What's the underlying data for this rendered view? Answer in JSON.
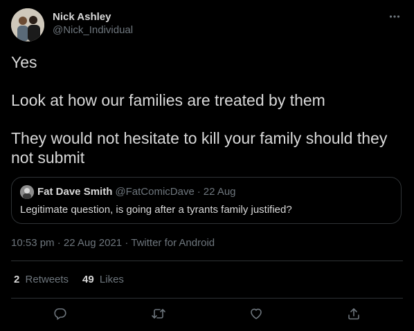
{
  "tweet": {
    "author": {
      "display_name": "Nick Ashley",
      "handle": "@Nick_Individual",
      "avatar_icon": "profile-photo-avatar"
    },
    "more_icon": "ellipsis-icon",
    "text_lines": [
      "Yes",
      "Look at how our families are treated by them",
      "They would not hesitate to kill your family should they not submit"
    ],
    "quote": {
      "display_name": "Fat Dave Smith",
      "handle": "@FatComicDave",
      "separator": "·",
      "date": "22 Aug",
      "text": "Legitimate question, is going after a tyrants family justified?"
    },
    "meta": {
      "time": "10:53 pm",
      "separator": "·",
      "date": "22 Aug 2021",
      "source": "Twitter for Android"
    },
    "stats": {
      "retweets_count": "2",
      "retweets_label": "Retweets",
      "likes_count": "49",
      "likes_label": "Likes"
    },
    "actions": [
      "reply-icon",
      "retweet-icon",
      "like-icon",
      "share-icon"
    ]
  },
  "colors": {
    "background": "#000000",
    "text": "#d9d9d9",
    "muted": "#6e767d",
    "border": "#2f3336"
  }
}
